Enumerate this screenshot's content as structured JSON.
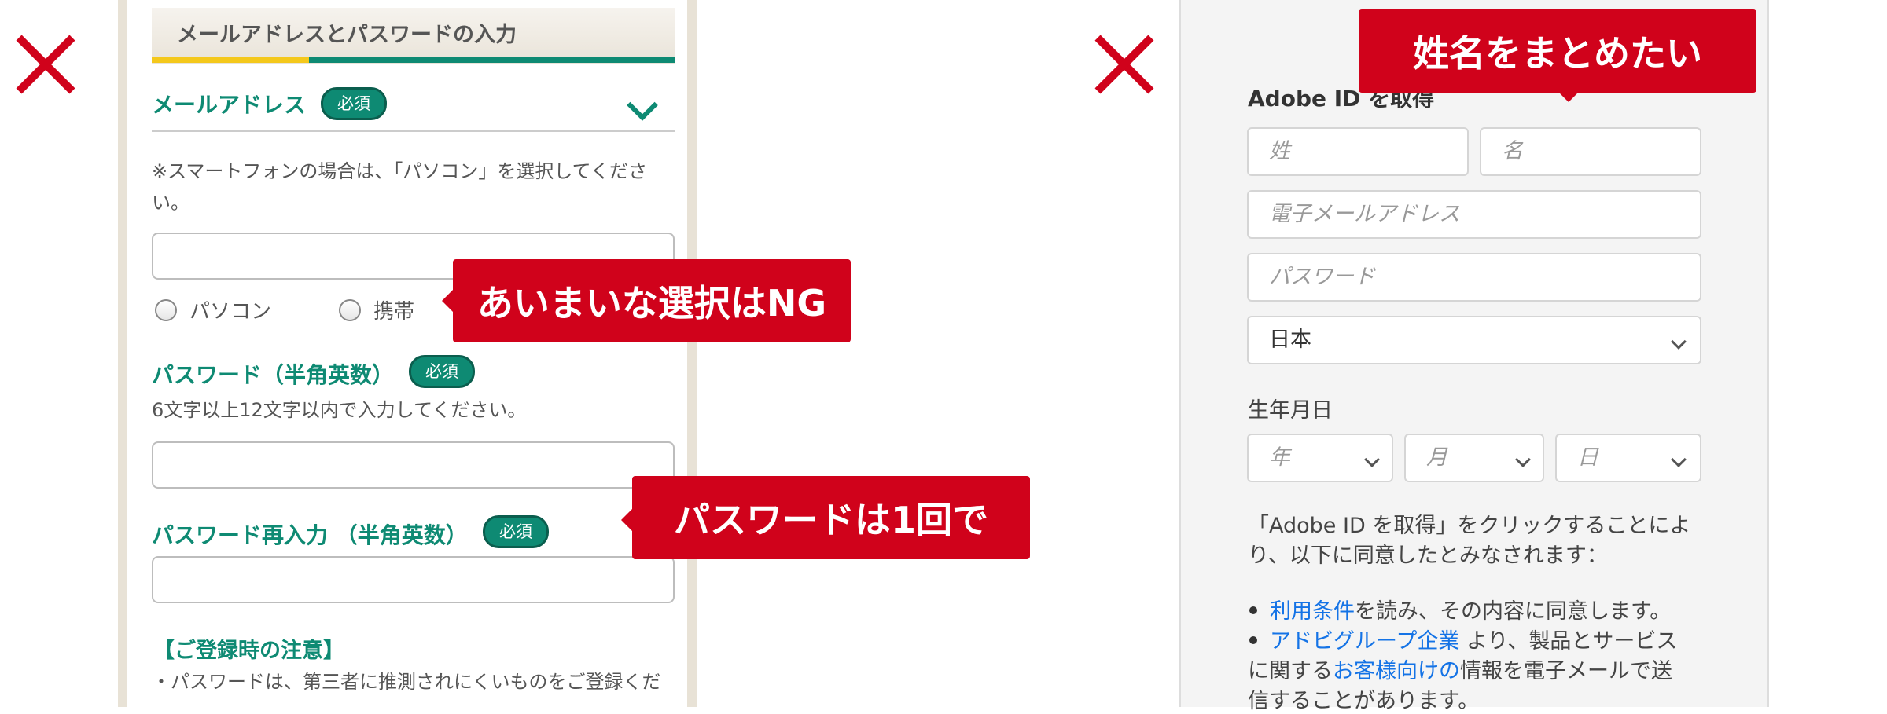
{
  "left": {
    "section_title": "メールアドレスとパスワードの入力",
    "email": {
      "label": "メールアドレス",
      "required": "必須",
      "note_line1": "※スマートフォンの場合は、「パソコン」を選択してくださ",
      "note_line2": "い。",
      "value": "",
      "radio_pc": "パソコン",
      "radio_mobile": "携帯"
    },
    "password": {
      "label": "パスワード（半角英数）",
      "required": "必須",
      "note": "6文字以上12文字以内で入力してください。",
      "value": ""
    },
    "password_confirm": {
      "label": "パスワード再入力 （半角英数）",
      "required": "必須",
      "value": ""
    },
    "caution_title": "【ご登録時の注意】",
    "caution_text": "・パスワードは、第三者に推測されにくいものをご登録くだ"
  },
  "callouts": {
    "ambiguous_choice": "あいまいな選択はNG",
    "password_once": "パスワードは1回で",
    "merge_names": "姓名をまとめたい"
  },
  "right": {
    "heading": "Adobe ID を取得",
    "last_name_placeholder": "姓",
    "first_name_placeholder": "名",
    "email_placeholder": "電子メールアドレス",
    "password_placeholder": "パスワード",
    "country_value": "日本",
    "birthdate_label": "生年月日",
    "year_placeholder": "年",
    "month_placeholder": "月",
    "day_placeholder": "日",
    "consent_line1": "「Adobe ID を取得」をクリックすることによ",
    "consent_line2": "り、以下に同意したとみなされます：",
    "bullet1_link": "利用条件",
    "bullet1_rest": "を読み、その内容に同意します。",
    "bullet2_link": "アドビグループ企業",
    "bullet2_rest": " より、製品とサービス",
    "bullet2_line2_pre": "に関する",
    "bullet2_line2_link": "お客様向けの",
    "bullet2_line2_post": "情報を電子メールで送",
    "bullet2_line3": "信することがあります。"
  },
  "colors": {
    "accent_red": "#d0021b",
    "accent_green": "#0e8a73",
    "stripe_yellow": "#f4c81c",
    "link_blue": "#1473e6"
  }
}
